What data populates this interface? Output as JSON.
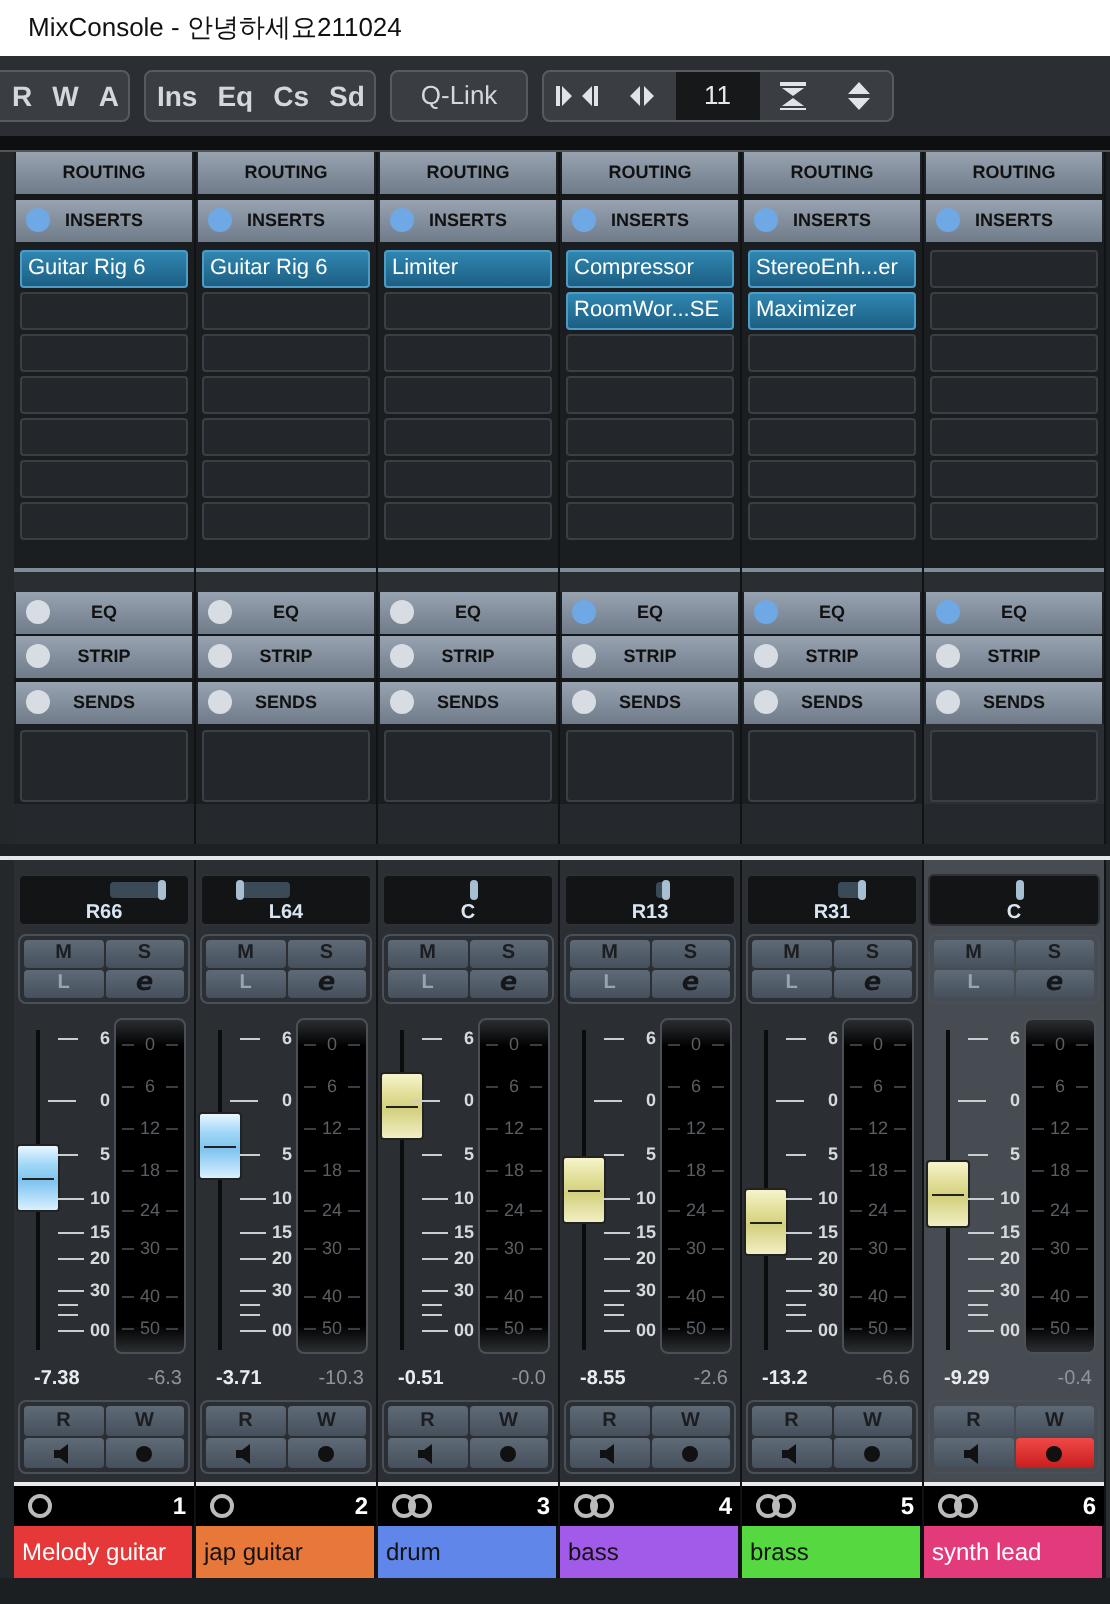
{
  "window": {
    "title": "MixConsole - 안녕하세요211024"
  },
  "toolbar": {
    "automation": [
      "R",
      "W",
      "A"
    ],
    "sections": [
      "Ins",
      "Eq",
      "Cs",
      "Sd"
    ],
    "qlink": "Q-Link",
    "channel_count": "11"
  },
  "channels": [
    {
      "selected": false,
      "routing": "ROUTING",
      "inserts": {
        "label": "INSERTS",
        "on": true,
        "slots": [
          {
            "kind": "plugin",
            "name": "Guitar Rig 6"
          },
          {
            "kind": "empty"
          },
          {
            "kind": "empty"
          },
          {
            "kind": "empty"
          },
          {
            "kind": "empty"
          },
          {
            "kind": "empty"
          },
          {
            "kind": "empty"
          }
        ]
      },
      "eq": {
        "label": "EQ",
        "on": false
      },
      "strip": {
        "label": "STRIP",
        "on": false
      },
      "sends": {
        "label": "SENDS",
        "on": false
      },
      "pan": {
        "label": "R66",
        "level": 0.83
      },
      "buttons": [
        "M",
        "S",
        "L",
        "e"
      ],
      "fader": {
        "kind": "blue",
        "level": 0.54
      },
      "fader_scale": [
        "6",
        "0",
        "5",
        "10",
        "15",
        "20",
        "30",
        "00"
      ],
      "meter_scale": [
        "0",
        "6",
        "12",
        "18",
        "24",
        "30",
        "40",
        "50"
      ],
      "volume": "-7.38",
      "peak": "-6.3",
      "read": "R",
      "write": "W",
      "record": false,
      "kind": "mono",
      "number": "1",
      "name": "Melody guitar",
      "color": "#e63838"
    },
    {
      "selected": false,
      "routing": "ROUTING",
      "inserts": {
        "label": "INSERTS",
        "on": true,
        "slots": [
          {
            "kind": "plugin",
            "name": "Guitar Rig 6"
          },
          {
            "kind": "empty"
          },
          {
            "kind": "empty"
          },
          {
            "kind": "empty"
          },
          {
            "kind": "empty"
          },
          {
            "kind": "empty"
          },
          {
            "kind": "empty"
          }
        ]
      },
      "eq": {
        "label": "EQ",
        "on": false
      },
      "strip": {
        "label": "STRIP",
        "on": false
      },
      "sends": {
        "label": "SENDS",
        "on": false
      },
      "pan": {
        "label": "L64",
        "level": 0.18
      },
      "buttons": [
        "M",
        "S",
        "L",
        "e"
      ],
      "fader": {
        "kind": "blue",
        "level": 0.64
      },
      "fader_scale": [
        "6",
        "0",
        "5",
        "10",
        "15",
        "20",
        "30",
        "00"
      ],
      "meter_scale": [
        "0",
        "6",
        "12",
        "18",
        "24",
        "30",
        "40",
        "50"
      ],
      "volume": "-3.71",
      "peak": "-10.3",
      "read": "R",
      "write": "W",
      "record": false,
      "kind": "mono",
      "number": "2",
      "name": "jap guitar",
      "color": "#e8783a"
    },
    {
      "selected": false,
      "routing": "ROUTING",
      "inserts": {
        "label": "INSERTS",
        "on": true,
        "slots": [
          {
            "kind": "plugin",
            "name": "Limiter"
          },
          {
            "kind": "empty"
          },
          {
            "kind": "empty"
          },
          {
            "kind": "empty"
          },
          {
            "kind": "empty"
          },
          {
            "kind": "empty"
          },
          {
            "kind": "empty"
          }
        ]
      },
      "eq": {
        "label": "EQ",
        "on": false
      },
      "strip": {
        "label": "STRIP",
        "on": false
      },
      "sends": {
        "label": "SENDS",
        "on": false
      },
      "pan": {
        "label": "C",
        "level": 0.5
      },
      "buttons": [
        "M",
        "S",
        "L",
        "e"
      ],
      "fader": {
        "kind": "yellow",
        "level": 0.76
      },
      "fader_scale": [
        "6",
        "0",
        "5",
        "10",
        "15",
        "20",
        "30",
        "00"
      ],
      "meter_scale": [
        "0",
        "6",
        "12",
        "18",
        "24",
        "30",
        "40",
        "50"
      ],
      "volume": "-0.51",
      "peak": "-0.0",
      "read": "R",
      "write": "W",
      "record": false,
      "kind": "stereo",
      "number": "3",
      "name": "drum",
      "color": "#5f86e8"
    },
    {
      "selected": false,
      "routing": "ROUTING",
      "inserts": {
        "label": "INSERTS",
        "on": true,
        "slots": [
          {
            "kind": "plugin",
            "name": "Compressor"
          },
          {
            "kind": "plugin",
            "name": "RoomWor...SE"
          },
          {
            "kind": "empty"
          },
          {
            "kind": "empty"
          },
          {
            "kind": "empty"
          },
          {
            "kind": "empty"
          },
          {
            "kind": "empty"
          }
        ]
      },
      "eq": {
        "label": "EQ",
        "on": true
      },
      "strip": {
        "label": "STRIP",
        "on": false
      },
      "sends": {
        "label": "SENDS",
        "on": false
      },
      "pan": {
        "label": "R13",
        "level": 0.565
      },
      "buttons": [
        "M",
        "S",
        "L",
        "e"
      ],
      "fader": {
        "kind": "yellow",
        "level": 0.5
      },
      "fader_scale": [
        "6",
        "0",
        "5",
        "10",
        "15",
        "20",
        "30",
        "00"
      ],
      "meter_scale": [
        "0",
        "6",
        "12",
        "18",
        "24",
        "30",
        "40",
        "50"
      ],
      "volume": "-8.55",
      "peak": "-2.6",
      "read": "R",
      "write": "W",
      "record": false,
      "kind": "stereo",
      "number": "4",
      "name": "bass",
      "color": "#a25ae8"
    },
    {
      "selected": false,
      "routing": "ROUTING",
      "inserts": {
        "label": "INSERTS",
        "on": true,
        "slots": [
          {
            "kind": "plugin",
            "name": "StereoEnh...er"
          },
          {
            "kind": "plugin",
            "name": "Maximizer"
          },
          {
            "kind": "empty"
          },
          {
            "kind": "empty"
          },
          {
            "kind": "empty"
          },
          {
            "kind": "empty"
          },
          {
            "kind": "empty"
          }
        ]
      },
      "eq": {
        "label": "EQ",
        "on": true
      },
      "strip": {
        "label": "STRIP",
        "on": false
      },
      "sends": {
        "label": "SENDS",
        "on": false
      },
      "pan": {
        "label": "R31",
        "level": 0.655
      },
      "buttons": [
        "M",
        "S",
        "L",
        "e"
      ],
      "fader": {
        "kind": "yellow",
        "level": 0.4
      },
      "fader_scale": [
        "6",
        "0",
        "5",
        "10",
        "15",
        "20",
        "30",
        "00"
      ],
      "meter_scale": [
        "0",
        "6",
        "12",
        "18",
        "24",
        "30",
        "40",
        "50"
      ],
      "volume": "-13.2",
      "peak": "-6.6",
      "read": "R",
      "write": "W",
      "record": false,
      "kind": "stereo",
      "number": "5",
      "name": "brass",
      "color": "#56d940"
    },
    {
      "selected": true,
      "routing": "ROUTING",
      "inserts": {
        "label": "INSERTS",
        "on": true,
        "slots": [
          {
            "kind": "empty"
          },
          {
            "kind": "empty"
          },
          {
            "kind": "empty"
          },
          {
            "kind": "empty"
          },
          {
            "kind": "empty"
          },
          {
            "kind": "empty"
          },
          {
            "kind": "empty"
          }
        ]
      },
      "eq": {
        "label": "EQ",
        "on": true
      },
      "strip": {
        "label": "STRIP",
        "on": false
      },
      "sends": {
        "label": "SENDS",
        "on": false
      },
      "pan": {
        "label": "C",
        "level": 0.5
      },
      "buttons": [
        "M",
        "S",
        "L",
        "e"
      ],
      "fader": {
        "kind": "yellow",
        "level": 0.49
      },
      "fader_scale": [
        "6",
        "0",
        "5",
        "10",
        "15",
        "20",
        "30",
        "00"
      ],
      "meter_scale": [
        "0",
        "6",
        "12",
        "18",
        "24",
        "30",
        "40",
        "50"
      ],
      "volume": "-9.29",
      "peak": "-0.4",
      "read": "R",
      "write": "W",
      "record": true,
      "kind": "stereo",
      "number": "6",
      "name": "synth lead",
      "color": "#e23a7a"
    }
  ]
}
